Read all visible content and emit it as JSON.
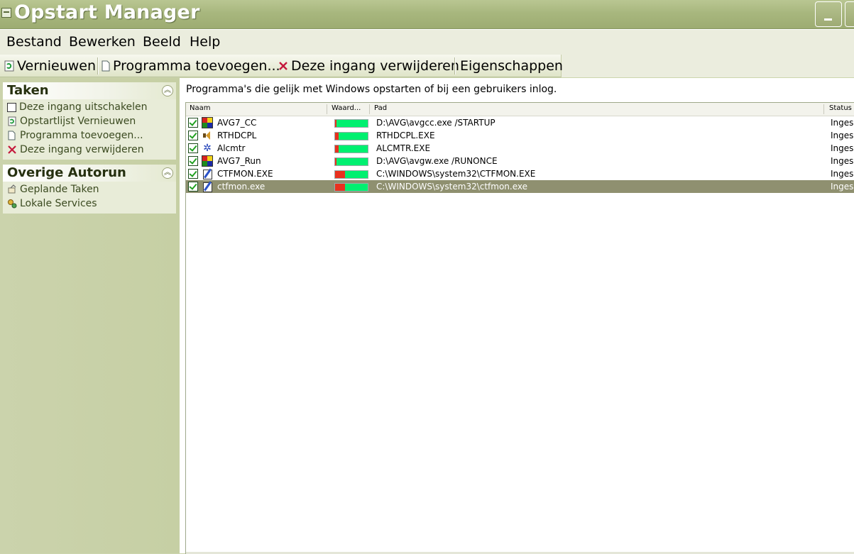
{
  "window": {
    "title": "Opstart Manager"
  },
  "menu": [
    "Bestand",
    "Bewerken",
    "Beeld",
    "Help"
  ],
  "toolbar": {
    "refresh": "Vernieuwen",
    "add": "Programma toevoegen...",
    "delete": "Deze ingang verwijderen",
    "properties": "Eigenschappen"
  },
  "tasks": {
    "title": "Taken",
    "items": [
      "Deze ingang uitschakelen",
      "Opstartlijst Vernieuwen",
      "Programma toevoegen...",
      "Deze ingang verwijderen"
    ]
  },
  "other": {
    "title": "Overige Autorun",
    "items": [
      "Geplande Taken",
      "Lokale Services"
    ]
  },
  "main": {
    "description": "Programma's die gelijk met Windows opstarten of bij een gebruikers inlog.",
    "columns": {
      "name": "Naam",
      "value": "Waard...",
      "path": "Pad",
      "status": "Status"
    },
    "rows": [
      {
        "name": "AVG7_CC",
        "path": "D:\\AVG\\avgcc.exe /STARTUP",
        "status": "Ingesc",
        "icon": "avg-icon",
        "value_fraction": 0.0,
        "selected": false
      },
      {
        "name": "RTHDCPL",
        "path": "RTHDCPL.EXE",
        "status": "Ingesc",
        "icon": "speaker-icon",
        "value_fraction": 0.1,
        "selected": false
      },
      {
        "name": "Alcmtr",
        "path": "ALCMTR.EXE",
        "status": "Ingesc",
        "icon": "alcmtr-icon",
        "value_fraction": 0.1,
        "selected": false
      },
      {
        "name": "AVG7_Run",
        "path": "D:\\AVG\\avgw.exe /RUNONCE",
        "status": "Ingesc",
        "icon": "avg-icon",
        "value_fraction": 0.0,
        "selected": false
      },
      {
        "name": "CTFMON.EXE",
        "path": "C:\\WINDOWS\\system32\\CTFMON.EXE",
        "status": "Ingesc",
        "icon": "pen-icon",
        "value_fraction": 0.3,
        "selected": false
      },
      {
        "name": "ctfmon.exe",
        "path": "C:\\WINDOWS\\system32\\ctfmon.exe",
        "status": "Ingesc",
        "icon": "pen-icon",
        "value_fraction": 0.3,
        "selected": true
      }
    ]
  }
}
